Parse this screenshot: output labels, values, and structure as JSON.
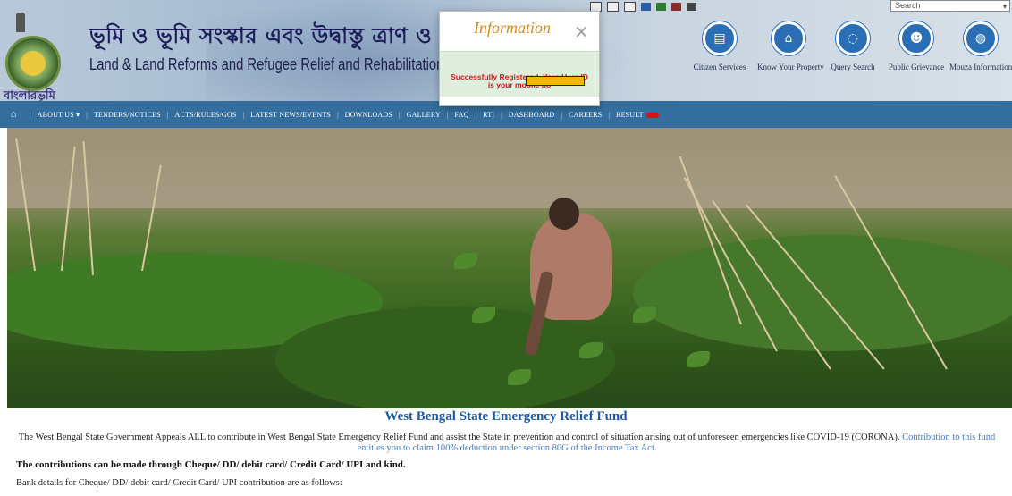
{
  "header": {
    "logo_text": "বাংলারভূমি",
    "title_bn": "ভূমি ও ভূমি সংস্কার এবং উদ্বাস্তু ত্রাণ ও পুনর্বাসন দপ্তর",
    "title_en": "Land & Land Reforms and Refugee Relief and Rehabilitation Department",
    "search_placeholder": "Search"
  },
  "services": [
    {
      "label": "Citizen Services",
      "icon": "id-card-icon"
    },
    {
      "label": "Know Your Property",
      "icon": "home-icon"
    },
    {
      "label": "Query Search",
      "icon": "chat-icon"
    },
    {
      "label": "Public Grievance",
      "icon": "people-icon"
    },
    {
      "label": "Mouza Information",
      "icon": "globe-icon"
    }
  ],
  "nav": {
    "items": [
      "ABOUT US",
      "TENDERS/NOTICES",
      "ACTS/RULES/GOS",
      "LATEST NEWS/EVENTS",
      "DOWNLOADS",
      "GALLERY",
      "FAQ",
      "RTI",
      "DASHBOARD",
      "CAREERS",
      "RESULT"
    ]
  },
  "modal": {
    "title": "Information",
    "close": "×",
    "message": "Successfully Registered. Your User ID is your mobile no"
  },
  "content": {
    "fund_title": "West Bengal State Emergency Relief Fund",
    "fund_desc": "The West Bengal State Government Appeals ALL to contribute in West Bengal State Emergency Relief Fund and assist the State in prevention and control of situation arising out of unforeseen emergencies like COVID-19 (CORONA).",
    "fund_link": "Contribution to this fund entitles you to claim 100% deduction under section 80G of the Income Tax Act.",
    "contrib_heading": "The contributions can be made through Cheque/ DD/ debit card/ Credit Card/ UPI and kind.",
    "bank_details": "Bank details for Cheque/ DD/ debit card/ Credit Card/ UPI contribution are as follows:"
  },
  "colors": {
    "nav_bg": "#336e9e",
    "accent_blue": "#1c5aa8",
    "icon_blue": "#2a6fb5",
    "modal_title": "#d28a1e",
    "error_red": "#d01818"
  }
}
